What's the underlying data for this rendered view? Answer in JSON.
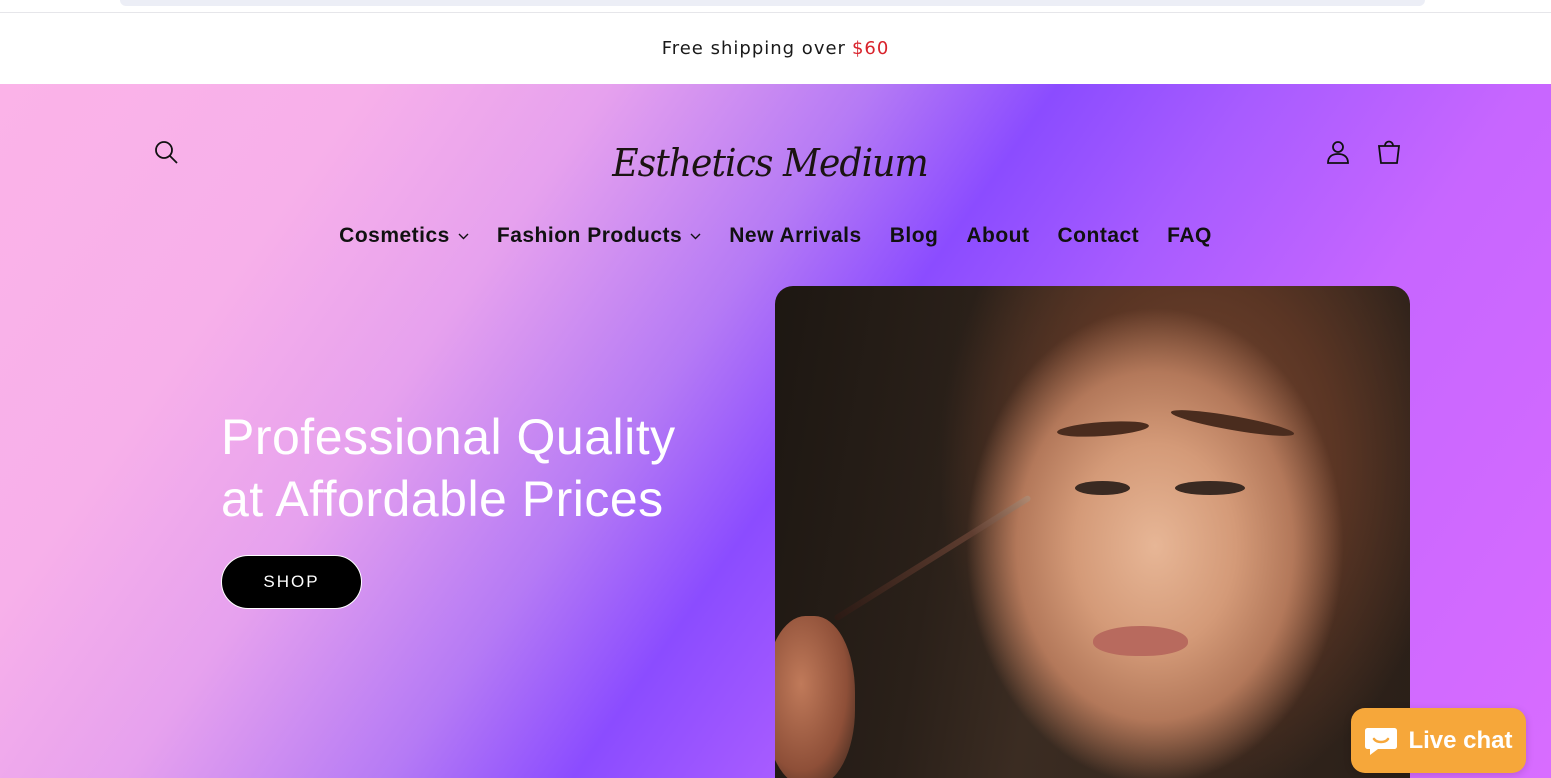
{
  "announcement": {
    "text": "Free shipping over",
    "price": "$60",
    "price_color": "#d8222b"
  },
  "header": {
    "logo_text": "Esthetics Medium",
    "icons": [
      "search-icon",
      "account-icon",
      "cart-icon"
    ]
  },
  "nav": {
    "items": [
      {
        "label": "Cosmetics",
        "has_dropdown": true
      },
      {
        "label": "Fashion Products",
        "has_dropdown": true
      },
      {
        "label": "New Arrivals",
        "has_dropdown": false
      },
      {
        "label": "Blog",
        "has_dropdown": false
      },
      {
        "label": "About",
        "has_dropdown": false
      },
      {
        "label": "Contact",
        "has_dropdown": false
      },
      {
        "label": "FAQ",
        "has_dropdown": false
      }
    ]
  },
  "hero": {
    "title_line1": "Professional Quality",
    "title_line2": "at Affordable Prices",
    "cta_label": "SHOP",
    "gradient_colors": [
      "#fbb3e8",
      "#8b4cff",
      "#d86cff"
    ]
  },
  "live_chat": {
    "label": "Live chat",
    "color": "#f6a73a"
  }
}
